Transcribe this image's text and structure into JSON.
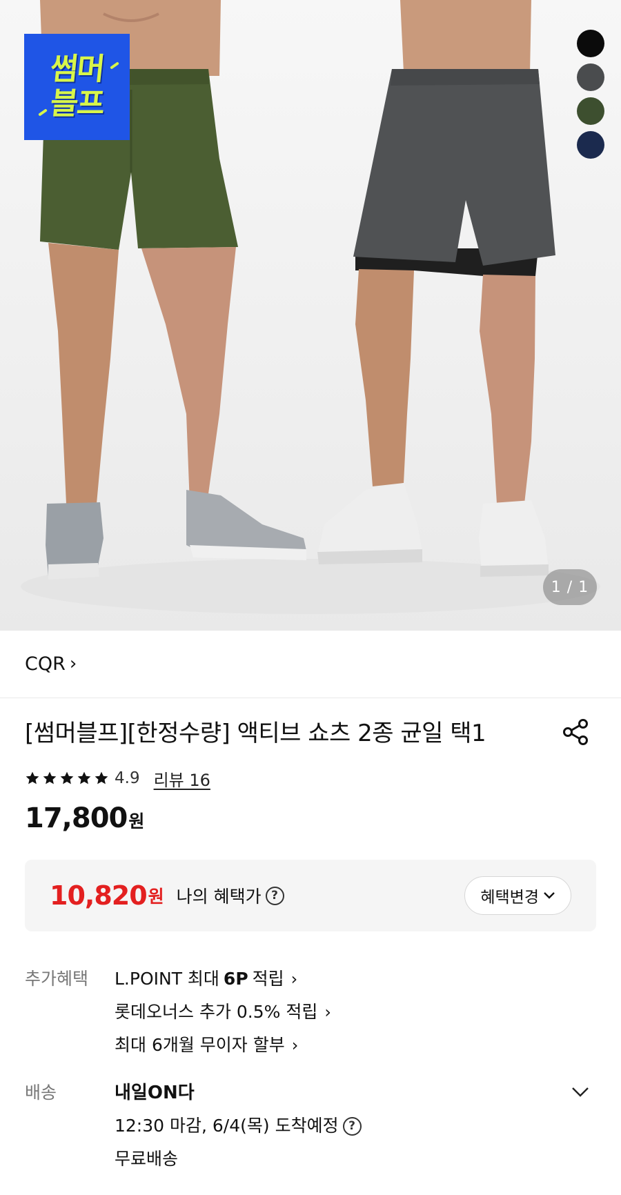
{
  "hero": {
    "badge": {
      "line1": "썸머",
      "line2": "블프"
    },
    "swatches": [
      "#0b0b0b",
      "#4a4c4e",
      "#3d4f2f",
      "#1b2a4e"
    ],
    "counter": "1 / 1"
  },
  "brand": {
    "name": "CQR",
    "chevron": "›"
  },
  "product": {
    "title": "[썸머블프][한정수량] 액티브 쇼츠 2종 균일 택1",
    "rating": "4.9",
    "stars": 5,
    "review_link": "리뷰 16",
    "price": "17,800",
    "currency": "원"
  },
  "benefit": {
    "price": "10,820",
    "currency": "원",
    "label": "나의 혜택가",
    "help": "?",
    "change_button": "혜택변경"
  },
  "extra": {
    "label": "추가혜택",
    "items": [
      {
        "prefix": "L.POINT 최대",
        "bold": "6P",
        "suffix": "적립"
      },
      {
        "text": "롯데오너스 추가 0.5% 적립"
      },
      {
        "text": "최대 6개월 무이자 할부"
      }
    ]
  },
  "shipping": {
    "label": "배송",
    "title": "내일ON다",
    "detail": "12:30 마감, 6/4(목) 도착예정",
    "fee": "무료배송"
  },
  "colors": {
    "accent_red": "#e32020",
    "badge_blue": "#1f55e6",
    "badge_text": "#d8f54a"
  }
}
